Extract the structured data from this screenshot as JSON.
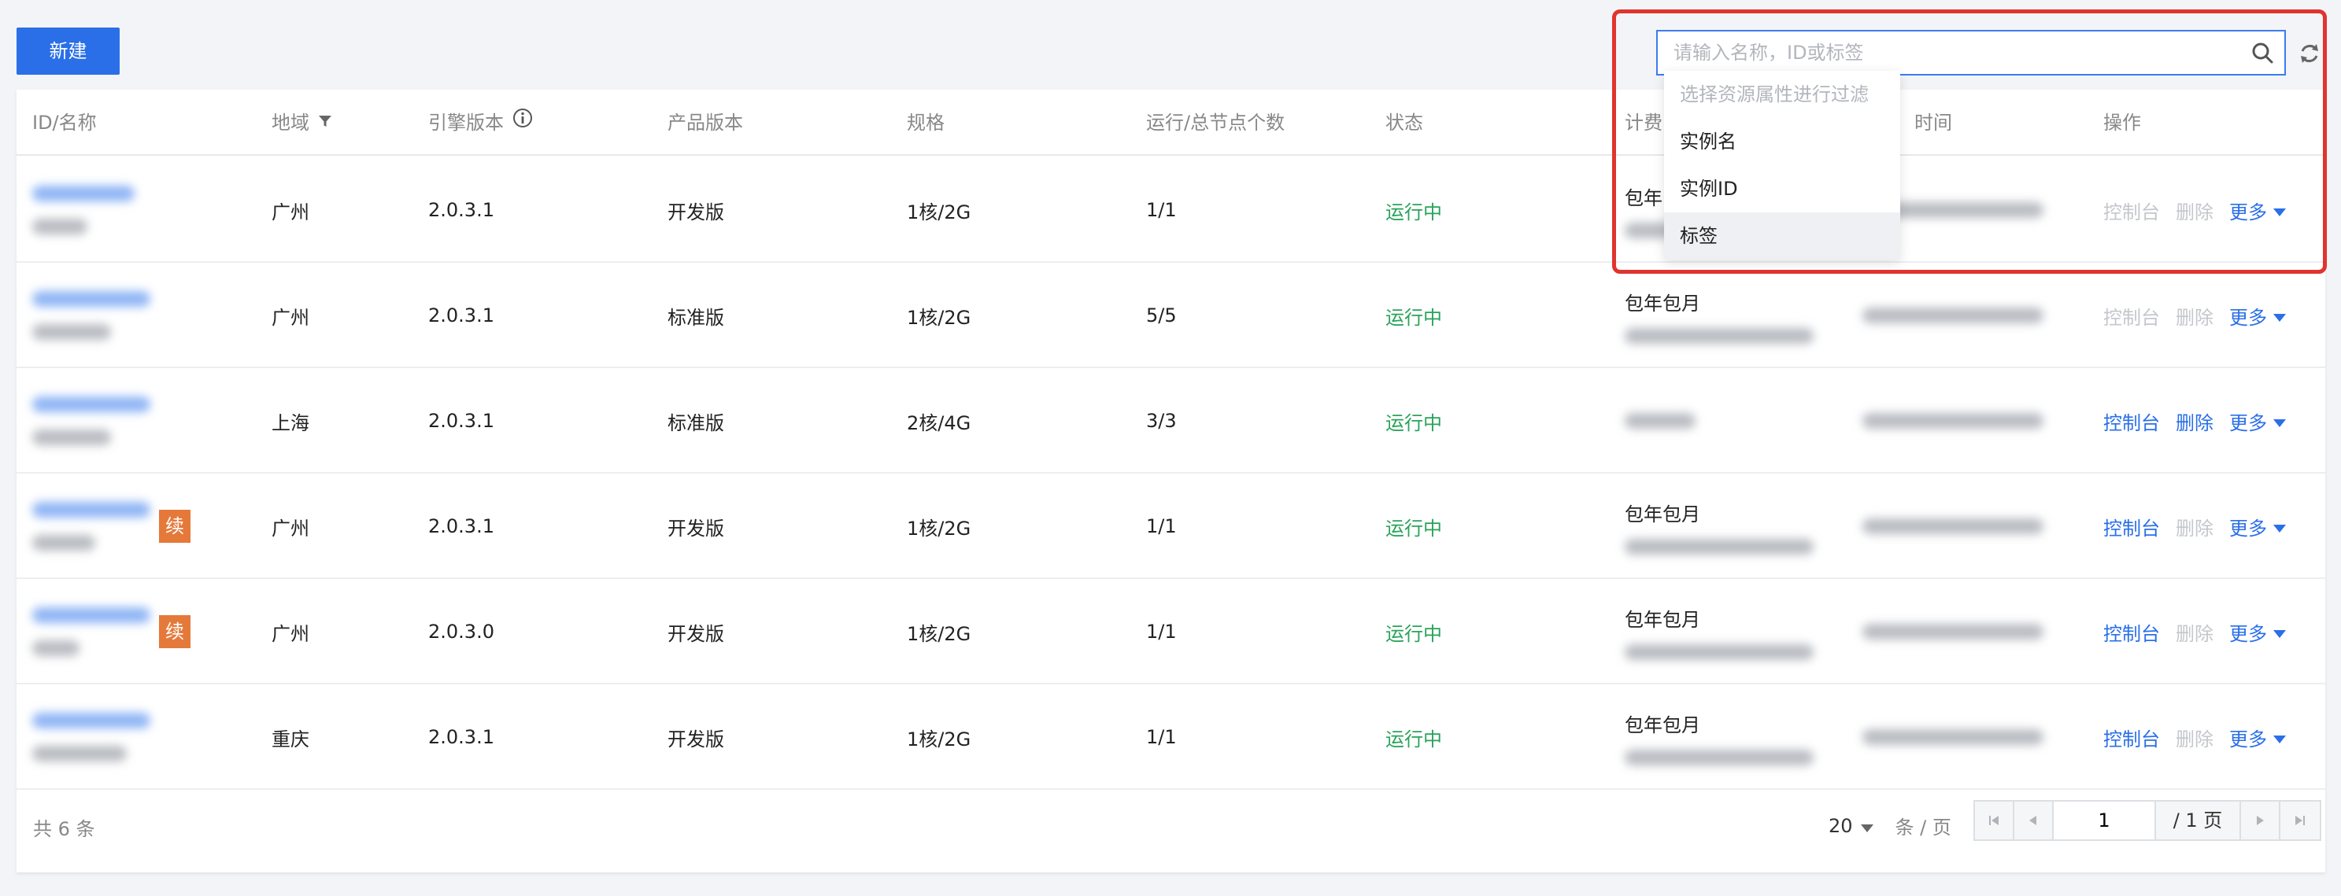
{
  "toolbar": {
    "new_label": "新建",
    "search_placeholder": "请输入名称，ID或标签"
  },
  "table": {
    "columns": {
      "id_name": "ID/名称",
      "region": "地域",
      "engine": "引擎版本",
      "product": "产品版本",
      "spec": "规格",
      "nodes": "运行/总节点个数",
      "status": "状态",
      "billing": "计费",
      "time": "时间",
      "ops": "操作"
    },
    "rows": [
      {
        "region": "广州",
        "engine": "2.0.3.1",
        "product": "开发版",
        "spec": "1核/2G",
        "nodes": "1/1",
        "status": "运行中",
        "billing": "包年",
        "renew": "",
        "ops": {
          "console": "控制台",
          "delete": "删除",
          "more": "更多",
          "console_enabled": false,
          "delete_enabled": false
        }
      },
      {
        "region": "广州",
        "engine": "2.0.3.1",
        "product": "标准版",
        "spec": "1核/2G",
        "nodes": "5/5",
        "status": "运行中",
        "billing": "包年包月",
        "renew": "",
        "ops": {
          "console": "控制台",
          "delete": "删除",
          "more": "更多",
          "console_enabled": false,
          "delete_enabled": false
        }
      },
      {
        "region": "上海",
        "engine": "2.0.3.1",
        "product": "标准版",
        "spec": "2核/4G",
        "nodes": "3/3",
        "status": "运行中",
        "billing": "",
        "renew": "",
        "ops": {
          "console": "控制台",
          "delete": "删除",
          "more": "更多",
          "console_enabled": true,
          "delete_enabled": true
        }
      },
      {
        "region": "广州",
        "engine": "2.0.3.1",
        "product": "开发版",
        "spec": "1核/2G",
        "nodes": "1/1",
        "status": "运行中",
        "billing": "包年包月",
        "renew": "续",
        "ops": {
          "console": "控制台",
          "delete": "删除",
          "more": "更多",
          "console_enabled": true,
          "delete_enabled": false
        }
      },
      {
        "region": "广州",
        "engine": "2.0.3.0",
        "product": "开发版",
        "spec": "1核/2G",
        "nodes": "1/1",
        "status": "运行中",
        "billing": "包年包月",
        "renew": "续",
        "ops": {
          "console": "控制台",
          "delete": "删除",
          "more": "更多",
          "console_enabled": true,
          "delete_enabled": false
        }
      },
      {
        "region": "重庆",
        "engine": "2.0.3.1",
        "product": "开发版",
        "spec": "1核/2G",
        "nodes": "1/1",
        "status": "运行中",
        "billing": "包年包月",
        "renew": "",
        "ops": {
          "console": "控制台",
          "delete": "删除",
          "more": "更多",
          "console_enabled": true,
          "delete_enabled": false
        }
      }
    ]
  },
  "footer": {
    "total_text": "共 6 条",
    "page_size": "20",
    "page_size_unit": "条 / 页",
    "current_page": "1",
    "total_pages": "/ 1 页"
  },
  "dropdown": {
    "hint": "选择资源属性进行过滤",
    "items": [
      "实例名",
      "实例ID",
      "标签"
    ],
    "active_index": 2
  },
  "colors": {
    "primary": "#2a6fe8",
    "status_running": "#29a35a",
    "renew_badge": "#e5793a",
    "highlight": "#e0342e"
  }
}
